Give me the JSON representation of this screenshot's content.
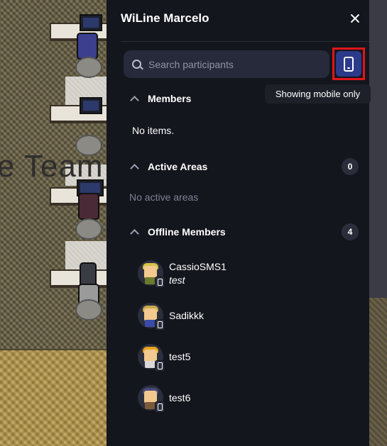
{
  "panel": {
    "title": "WiLine Marcelo"
  },
  "search": {
    "placeholder": "Search participants"
  },
  "mobile_filter": {
    "tooltip": "Showing mobile only",
    "highlight_color": "#e2141b"
  },
  "map": {
    "sign_text": "e Team"
  },
  "sections": {
    "members": {
      "title": "Members",
      "empty_text": "No items."
    },
    "active_areas": {
      "title": "Active Areas",
      "count": "0",
      "empty_text": "No active areas"
    },
    "offline_members": {
      "title": "Offline Members",
      "count": "4",
      "items": [
        {
          "name": "CassioSMS1",
          "status": "test",
          "device": "mobile-icon"
        },
        {
          "name": "Sadikkk",
          "device": "mobile-icon"
        },
        {
          "name": "test5",
          "device": "mobile-icon"
        },
        {
          "name": "test6",
          "device": "mobile-icon"
        }
      ]
    }
  }
}
